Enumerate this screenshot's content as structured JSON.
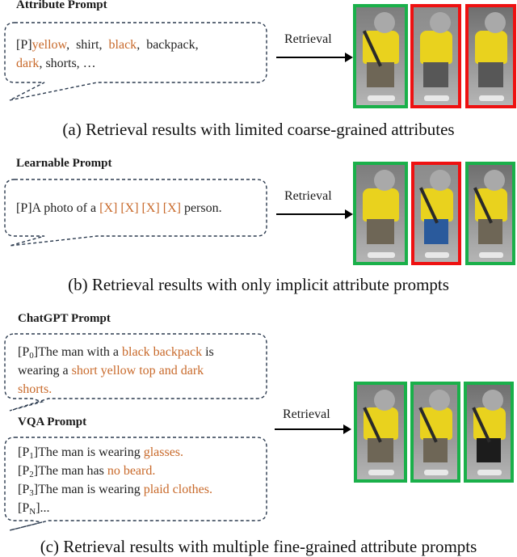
{
  "colors": {
    "highlight": "#c8692a",
    "match_border": "#1ab04a",
    "mismatch_border": "#ee1111",
    "bubble_stroke": "#2b3a4e",
    "face_blur": "#a9a9a9"
  },
  "panels": [
    {
      "id": "a",
      "heading": "Attribute Prompt",
      "prompt_segments": [
        {
          "text": "[P]",
          "highlight": false
        },
        {
          "text": "yellow",
          "highlight": true
        },
        {
          "text": ",  shirt,  ",
          "highlight": false
        },
        {
          "text": "black",
          "highlight": true
        },
        {
          "text": ",  backpack,",
          "highlight": false
        },
        {
          "text": "\n",
          "highlight": false
        },
        {
          "text": "dark",
          "highlight": true
        },
        {
          "text": ", shorts, …",
          "highlight": false
        }
      ],
      "arrow_label": "Retrieval",
      "results": [
        {
          "match": true,
          "description": "yellow top, plaid shorts, backpack"
        },
        {
          "match": false,
          "description": "striped yellow top, grey shorts"
        },
        {
          "match": false,
          "description": "yellow top, dark shorts"
        }
      ],
      "caption": "(a) Retrieval results with limited coarse-grained attributes"
    },
    {
      "id": "b",
      "heading": "Learnable Prompt",
      "prompt_segments": [
        {
          "text": "[P]A photo of a ",
          "highlight": false
        },
        {
          "text": "[X] [X] [X] [X]",
          "highlight": true
        },
        {
          "text": " person.",
          "highlight": false
        }
      ],
      "arrow_label": "Retrieval",
      "results": [
        {
          "match": true,
          "description": "yellow top, plaid shorts"
        },
        {
          "match": false,
          "description": "yellow top, blue shorts, shoulder bag"
        },
        {
          "match": true,
          "description": "yellow top, plaid shorts, backpack"
        }
      ],
      "caption": "(b) Retrieval results with only implicit attribute prompts"
    },
    {
      "id": "c",
      "chatgpt_heading": "ChatGPT Prompt",
      "chatgpt_lines": [
        [
          {
            "text": "[P",
            "highlight": false
          },
          {
            "sub": "0"
          },
          {
            "text": "]The man with a ",
            "highlight": false
          },
          {
            "text": "black backpack",
            "highlight": true
          },
          {
            "text": " is",
            "highlight": false
          }
        ],
        [
          {
            "text": "wearing a ",
            "highlight": false
          },
          {
            "text": "short yellow top and dark",
            "highlight": true
          }
        ],
        [
          {
            "text": "shorts.",
            "highlight": true
          }
        ]
      ],
      "vqa_heading": "VQA Prompt",
      "vqa_lines": [
        [
          {
            "text": "[P",
            "highlight": false
          },
          {
            "sub": "1"
          },
          {
            "text": "]The man is wearing ",
            "highlight": false
          },
          {
            "text": "glasses.",
            "highlight": true
          }
        ],
        [
          {
            "text": "[P",
            "highlight": false
          },
          {
            "sub": "2"
          },
          {
            "text": "]The man has ",
            "highlight": false
          },
          {
            "text": "no beard.",
            "highlight": true
          }
        ],
        [
          {
            "text": "[P",
            "highlight": false
          },
          {
            "sub": "3"
          },
          {
            "text": "]The man is wearing ",
            "highlight": false
          },
          {
            "text": "plaid clothes.",
            "highlight": true
          }
        ],
        [
          {
            "text": "[P",
            "highlight": false
          },
          {
            "sub": "N"
          },
          {
            "text": "]...",
            "highlight": false
          }
        ]
      ],
      "arrow_label": "Retrieval",
      "results": [
        {
          "match": true,
          "description": "yellow top, plaid shorts, black backpack"
        },
        {
          "match": true,
          "description": "yellow top, plaid shorts, backpack"
        },
        {
          "match": true,
          "description": "yellow top, black pants, backpack"
        }
      ],
      "caption": "(c) Retrieval results with multiple fine-grained attribute prompts"
    }
  ]
}
